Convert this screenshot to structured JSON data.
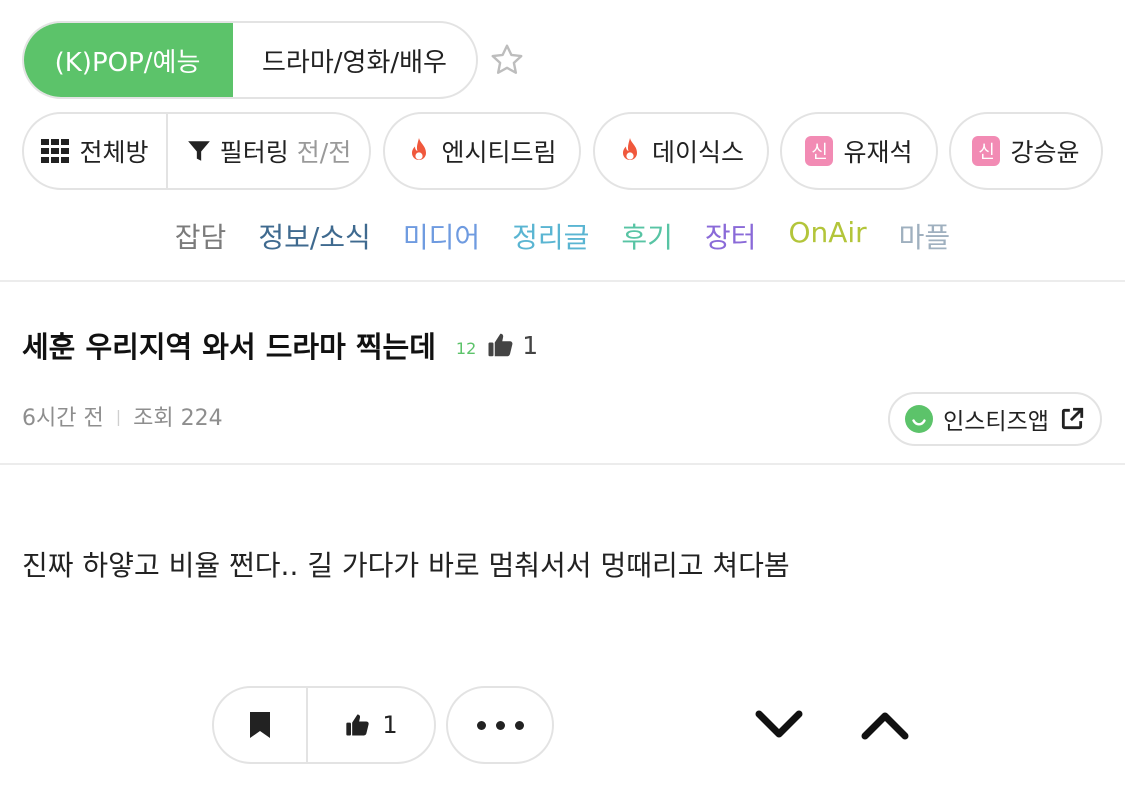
{
  "top_tabs": {
    "active": "(K)POP/예능",
    "other": "드라마/영화/배우"
  },
  "pills": {
    "all_label": "전체방",
    "filter_label": "필터링",
    "filter_state": "전/전",
    "boards": [
      {
        "label": "엔시티드림",
        "icon": "fire-icon"
      },
      {
        "label": "데이식스",
        "icon": "fire-icon"
      },
      {
        "label": "유재석",
        "badge": "신"
      },
      {
        "label": "강승윤",
        "badge": "신"
      }
    ]
  },
  "categories": [
    {
      "label": "잡담",
      "color": "#7b7b7b"
    },
    {
      "label": "정보/소식",
      "color": "#3f6a8f"
    },
    {
      "label": "미디어",
      "color": "#6f9be0"
    },
    {
      "label": "정리글",
      "color": "#5ab5d2"
    },
    {
      "label": "후기",
      "color": "#58c4a4"
    },
    {
      "label": "장터",
      "color": "#8a6ad8"
    },
    {
      "label": "OnAir",
      "color": "#b3c53a"
    },
    {
      "label": "마플",
      "color": "#9fb0bf"
    }
  ],
  "post": {
    "title": "세훈 우리지역 와서 드라마 찍는데",
    "comment_count": "12",
    "like_count": "1",
    "time_ago": "6시간 전",
    "views": "조회 224",
    "app_button": "인스티즈앱",
    "body": "진짜 하얗고 비율 쩐다.. 길 가다가 바로 멈춰서서 멍때리고 쳐다봄"
  },
  "actions": {
    "like_count": "1"
  },
  "colors": {
    "accent": "#5cc36a",
    "fire": "#f0583c",
    "new_badge": "#f28bb4"
  }
}
